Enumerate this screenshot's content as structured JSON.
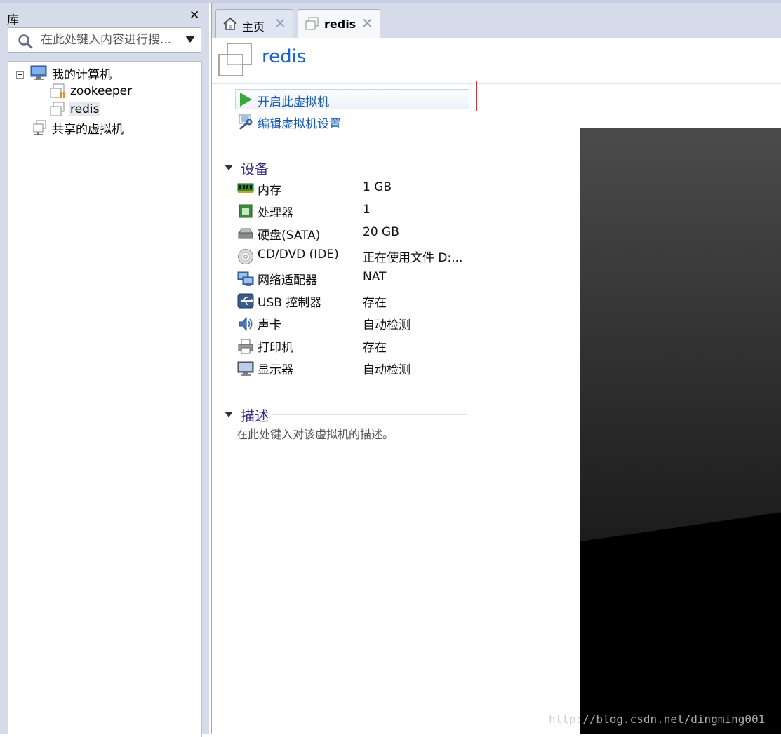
{
  "library": {
    "title": "库",
    "search": {
      "placeholder": "在此处键入内容进行搜..."
    },
    "tree": {
      "my_computer": "我的计算机",
      "vms": [
        "zookeeper",
        "redis"
      ],
      "shared_vms": "共享的虚拟机",
      "selected": "redis"
    }
  },
  "tabs": [
    {
      "label": "主页",
      "icon": "home-icon",
      "active": false
    },
    {
      "label": "redis",
      "icon": "vm-icon",
      "active": true
    }
  ],
  "vm": {
    "title": "redis",
    "actions": {
      "power_on": "开启此虚拟机",
      "edit_settings": "编辑虚拟机设置"
    },
    "devices_title": "设备",
    "devices": [
      {
        "name": "内存",
        "value": "1 GB",
        "icon": "memory-icon"
      },
      {
        "name": "处理器",
        "value": "1",
        "icon": "processor-icon"
      },
      {
        "name": "硬盘(SATA)",
        "value": "20 GB",
        "icon": "hard-disk-icon"
      },
      {
        "name": "CD/DVD (IDE)",
        "value": "正在使用文件 D:...",
        "icon": "cd-dvd-icon"
      },
      {
        "name": "网络适配器",
        "value": "NAT",
        "icon": "network-adapter-icon"
      },
      {
        "name": "USB 控制器",
        "value": "存在",
        "icon": "usb-icon"
      },
      {
        "name": "声卡",
        "value": "自动检测",
        "icon": "sound-card-icon"
      },
      {
        "name": "打印机",
        "value": "存在",
        "icon": "printer-icon"
      },
      {
        "name": "显示器",
        "value": "自动检测",
        "icon": "display-icon"
      }
    ],
    "description_title": "描述",
    "description_placeholder": "在此处键入对该虚拟机的描述。"
  },
  "watermark": "http://blog.csdn.net/dingming001",
  "colors": {
    "accent": "#1a63c8",
    "link": "#1a5fb4",
    "section_title": "#3a2f88",
    "play": "#38a937",
    "highlight_border": "#d13b3b",
    "panel_bg": "#d5dbe9"
  }
}
